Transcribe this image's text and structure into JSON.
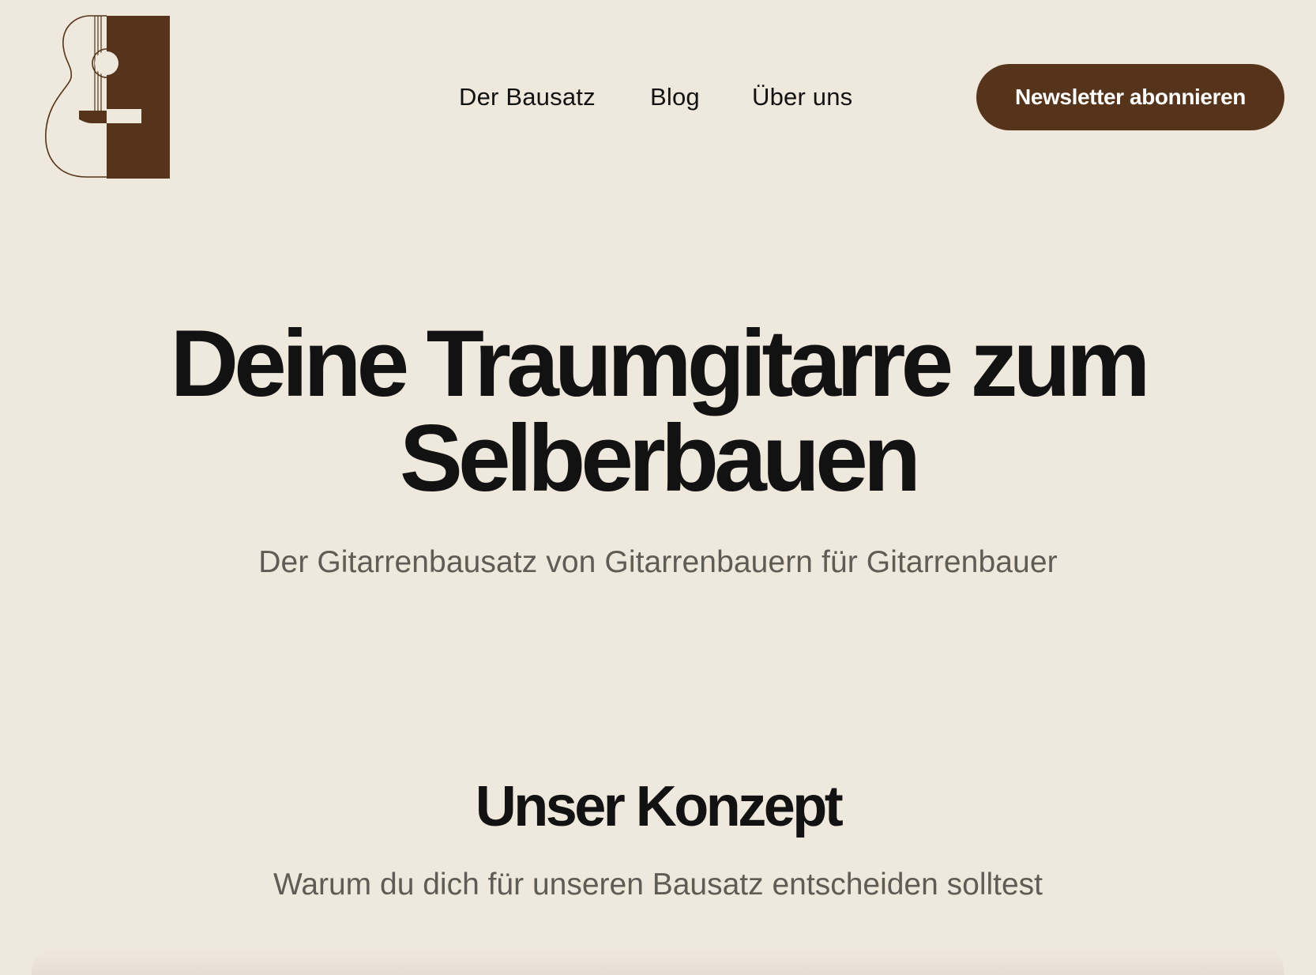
{
  "colors": {
    "background": "#efe8dd",
    "brand": "#55341b",
    "text": "#121212",
    "muted_text": "#5f5b55",
    "button_text": "#ffffff"
  },
  "header": {
    "logo_icon": "guitar-logo-icon",
    "nav": [
      {
        "label": "Der Bausatz"
      },
      {
        "label": "Blog"
      },
      {
        "label": "Über uns"
      }
    ],
    "cta_label": "Newsletter abonnieren"
  },
  "hero": {
    "title_line1": "Deine Traumgitarre zum",
    "title_line2": "Selberbauen",
    "subtitle": "Der Gitarrenbausatz von Gitarrenbauern für Gitarrenbauer"
  },
  "concept": {
    "title": "Unser Konzept",
    "subtitle": "Warum du dich für unseren Bausatz entscheiden solltest"
  }
}
